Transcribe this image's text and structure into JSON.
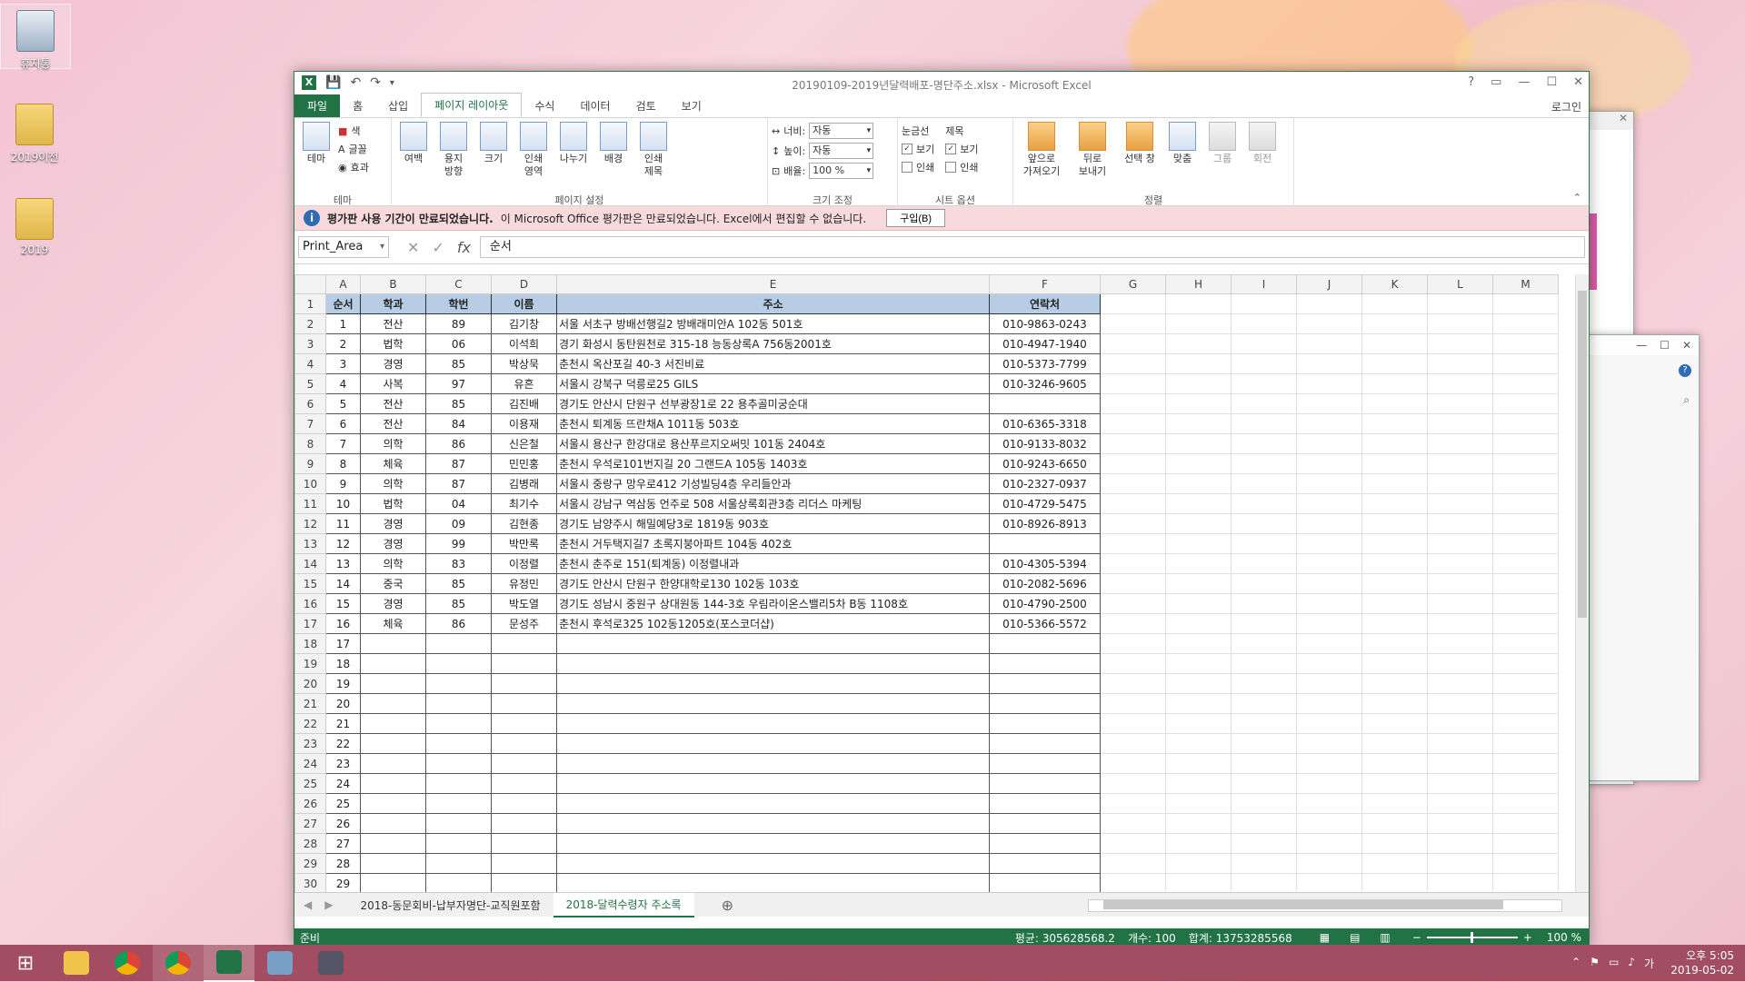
{
  "desktop": {
    "icons": [
      {
        "label": "휴지통"
      },
      {
        "label": "2019이전"
      },
      {
        "label": "2019"
      }
    ]
  },
  "excel": {
    "window_title": "20190109-2019년달력배포-명단주소.xlsx - Microsoft Excel",
    "tabs": [
      "파일",
      "홈",
      "삽입",
      "페이지 레이아웃",
      "수식",
      "데이터",
      "검토",
      "보기"
    ],
    "active_tab": "페이지 레이아웃",
    "login": "로그인",
    "ribbon": {
      "theme_group": {
        "label": "테마",
        "theme_btn": "테마",
        "colors": "색",
        "fonts": "글꼴",
        "effects": "효과"
      },
      "page_setup": {
        "label": "페이지 설정",
        "margins": "여백",
        "orientation": "용지\n방향",
        "size": "크기",
        "print_area": "인쇄\n영역",
        "breaks": "나누기",
        "background": "배경",
        "print_titles": "인쇄\n제목"
      },
      "scale": {
        "label": "크기 조정",
        "width_label": "너비:",
        "width_value": "자동",
        "height_label": "높이:",
        "height_value": "자동",
        "scale_label": "배율:",
        "scale_value": "100 %"
      },
      "sheet_options": {
        "label": "시트 옵션",
        "gridlines": "눈금선",
        "headings": "제목",
        "view": "보기",
        "print": "인쇄"
      },
      "arrange": {
        "label": "정렬",
        "bring_forward": "앞으로\n가져오기",
        "send_backward": "뒤로\n보내기",
        "selection_pane": "선택 창",
        "align": "맞춤",
        "group": "그룹",
        "rotate": "회전"
      }
    },
    "message_bar": {
      "bold": "평가판 사용 기간이 만료되었습니다.",
      "text": "이 Microsoft Office 평가판은 만료되었습니다. Excel에서 편집할 수 없습니다.",
      "button": "구입(B)"
    },
    "name_box": "Print_Area",
    "formula": "순서",
    "columns": [
      "A",
      "B",
      "C",
      "D",
      "E",
      "F",
      "G",
      "H",
      "I",
      "J",
      "K",
      "L",
      "M"
    ],
    "header_row": [
      "순서",
      "학과",
      "학번",
      "이름",
      "주소",
      "연락처"
    ],
    "rows": [
      [
        "1",
        "전산",
        "89",
        "김기창",
        "서울 서초구 방배선행길2 방배래미안A 102동 501호",
        "010-9863-0243"
      ],
      [
        "2",
        "법학",
        "06",
        "이석희",
        "경기 화성시 동탄원천로 315-18 능동상록A 756동2001호",
        "010-4947-1940"
      ],
      [
        "3",
        "경영",
        "85",
        "박상묵",
        "춘천시 옥산포길 40-3 서진비료",
        "010-5373-7799"
      ],
      [
        "4",
        "사복",
        "97",
        "유흔",
        "서울시 강북구 덕릉로25 GILS",
        "010-3246-9605"
      ],
      [
        "5",
        "전산",
        "85",
        "김진배",
        "경기도 안산시 단원구 선부광장1로 22 용추골미궁순대",
        ""
      ],
      [
        "6",
        "전산",
        "84",
        "이용재",
        "춘천시 퇴계동 뜨란채A 1011동 503호",
        "010-6365-3318"
      ],
      [
        "7",
        "의학",
        "86",
        "신은철",
        "서울시 용산구 한강대로 용산푸르지오써밋 101동 2404호",
        "010-9133-8032"
      ],
      [
        "8",
        "체육",
        "87",
        "민민홍",
        "춘천시 우석로101번지길 20 그랜드A 105동 1403호",
        "010-9243-6650"
      ],
      [
        "9",
        "의학",
        "87",
        "김병래",
        "서울시 중랑구 망우로412 기성빌딩4층 우리들안과",
        "010-2327-0937"
      ],
      [
        "10",
        "법학",
        "04",
        "최기수",
        "서울시 강남구 역삼동 언주로 508 서울상록회관3층 리더스 마케팅",
        "010-4729-5475"
      ],
      [
        "11",
        "경영",
        "09",
        "김현종",
        "경기도 남양주시 해밀예당3로 1819동 903호",
        "010-8926-8913"
      ],
      [
        "12",
        "경영",
        "99",
        "박만록",
        "춘천시 거두택지길7 초록지붕아파트 104동 402호",
        ""
      ],
      [
        "13",
        "의학",
        "83",
        "이정렬",
        "춘천시 춘주로 151(퇴계동) 이정렬내과",
        "010-4305-5394"
      ],
      [
        "14",
        "중국",
        "85",
        "유정민",
        "경기도 안산시 단원구 한양대학로130 102동 103호",
        "010-2082-5696"
      ],
      [
        "15",
        "경영",
        "85",
        "박도열",
        "경기도 성남시 중원구 상대원동 144-3호 우림라이온스밸리5차 B동 1108호",
        "010-4790-2500"
      ],
      [
        "16",
        "체육",
        "86",
        "문성주",
        "춘천시 후석로325 102동1205호(포스코더샵)",
        "010-5366-5572"
      ],
      [
        "17",
        "",
        "",
        "",
        "",
        ""
      ],
      [
        "18",
        "",
        "",
        "",
        "",
        ""
      ],
      [
        "19",
        "",
        "",
        "",
        "",
        ""
      ],
      [
        "20",
        "",
        "",
        "",
        "",
        ""
      ],
      [
        "21",
        "",
        "",
        "",
        "",
        ""
      ],
      [
        "22",
        "",
        "",
        "",
        "",
        ""
      ],
      [
        "23",
        "",
        "",
        "",
        "",
        ""
      ],
      [
        "24",
        "",
        "",
        "",
        "",
        ""
      ],
      [
        "25",
        "",
        "",
        "",
        "",
        ""
      ],
      [
        "26",
        "",
        "",
        "",
        "",
        ""
      ],
      [
        "27",
        "",
        "",
        "",
        "",
        ""
      ],
      [
        "28",
        "",
        "",
        "",
        "",
        ""
      ],
      [
        "29",
        "",
        "",
        "",
        "",
        ""
      ]
    ],
    "sheet_tabs": [
      "2018-동문회비-납부자명단-교직원포함",
      "2018-달력수령자 주소록"
    ],
    "active_sheet": 1,
    "status": {
      "ready": "준비",
      "average": "평균: 305628568.2",
      "count": "개수: 100",
      "sum": "합계: 13753285568",
      "zoom": "100 %"
    }
  },
  "taskbar": {
    "time": "오후 5:05",
    "date": "2019-05-02",
    "ime": "가"
  },
  "colors": {
    "excel_green": "#217346",
    "header_fill": "#b7cde6",
    "message_bar": "#f8d9dc",
    "taskbar": "#a34d62"
  }
}
